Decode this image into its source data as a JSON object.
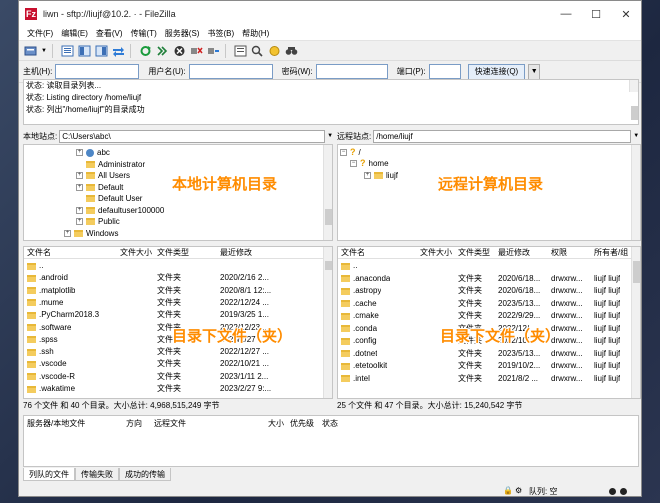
{
  "window": {
    "title": "liwn - sftp://liujf@10.2.  ·  - FileZilla",
    "app_icon": "Fz",
    "controls": [
      "—",
      "☐",
      "✕"
    ]
  },
  "menu": [
    "文件(F)",
    "编辑(E)",
    "查看(V)",
    "传输(T)",
    "服务器(S)",
    "书签(B)",
    "帮助(H)"
  ],
  "toolbar_icons": [
    "site-manager-icon",
    "dropdown-icon",
    "toggle-log-icon",
    "toggle-local-tree-icon",
    "toggle-remote-tree-icon",
    "toggle-queue-icon",
    "refresh-icon",
    "process-queue-icon",
    "cancel-icon",
    "disconnect-icon",
    "reconnect-icon",
    "filter-icon",
    "compare-icon",
    "sync-browse-icon",
    "search-icon"
  ],
  "quickconnect": {
    "host_label": "主机(H):",
    "user_label": "用户名(U):",
    "pass_label": "密码(W):",
    "port_label": "端口(P):",
    "host_value": "",
    "user_value": "",
    "pass_value": "",
    "port_value": "",
    "button": "快速连接(Q)",
    "dropdown": "▼"
  },
  "log": [
    "状态: 读取目录列表...",
    "状态: Listing directory /home/liujf",
    "状态: 列出\"/home/liujf\"的目录成功"
  ],
  "local": {
    "site_label": "本地站点:",
    "path": "C:\\Users\\abc\\",
    "tree": [
      {
        "name": "abc",
        "type": "user",
        "expander": "+"
      },
      {
        "name": "Administrator",
        "type": "folder",
        "expander": ""
      },
      {
        "name": "All Users",
        "type": "folder",
        "expander": "+"
      },
      {
        "name": "Default",
        "type": "folder",
        "expander": "+"
      },
      {
        "name": "Default User",
        "type": "folder",
        "expander": ""
      },
      {
        "name": "defaultuser100000",
        "type": "folder",
        "expander": "+"
      },
      {
        "name": "Public",
        "type": "folder",
        "expander": "+"
      },
      {
        "name": "Windows",
        "type": "folder",
        "expander": "+"
      }
    ],
    "columns": [
      "文件名",
      "文件大小",
      "文件类型",
      "最近修改"
    ],
    "files": [
      {
        "name": "..",
        "size": "",
        "type": "",
        "modified": ""
      },
      {
        "name": ".android",
        "size": "",
        "type": "文件夹",
        "modified": "2020/2/16 2..."
      },
      {
        "name": ".matplotlib",
        "size": "",
        "type": "文件夹",
        "modified": "2020/8/1 12:..."
      },
      {
        "name": ".mume",
        "size": "",
        "type": "文件夹",
        "modified": "2022/12/24 ..."
      },
      {
        "name": ".PyCharm2018.3",
        "size": "",
        "type": "文件夹",
        "modified": "2019/3/25 1..."
      },
      {
        "name": ".software",
        "size": "",
        "type": "文件夹",
        "modified": "2022/12/23 ..."
      },
      {
        "name": ".spss",
        "size": "",
        "type": "文件夹",
        "modified": "2023/2/27 ..."
      },
      {
        "name": ".ssh",
        "size": "",
        "type": "文件夹",
        "modified": "2022/12/27 ..."
      },
      {
        "name": ".vscode",
        "size": "",
        "type": "文件夹",
        "modified": "2022/10/21 ..."
      },
      {
        "name": ".vscode-R",
        "size": "",
        "type": "文件夹",
        "modified": "2023/1/11 2..."
      },
      {
        "name": ".wakatime",
        "size": "",
        "type": "文件夹",
        "modified": "2023/2/27 9:..."
      }
    ],
    "status": "76 个文件 和 40 个目录。大小总计: 4,968,515,249 字节"
  },
  "remote": {
    "site_label": "远程站点:",
    "path": "/home/liujf",
    "tree": [
      {
        "name": "/",
        "type": "unknown",
        "expander": "−"
      },
      {
        "name": "home",
        "type": "unknown",
        "expander": "−"
      },
      {
        "name": "liujf",
        "type": "folder",
        "expander": "+"
      }
    ],
    "columns": [
      "文件名",
      "文件大小",
      "文件类型",
      "最近修改",
      "权限",
      "所有者/组"
    ],
    "files": [
      {
        "name": "..",
        "size": "",
        "type": "",
        "modified": "",
        "perm": "",
        "owner": ""
      },
      {
        "name": ".anaconda",
        "size": "",
        "type": "文件夹",
        "modified": "2020/6/18...",
        "perm": "drwxrw...",
        "owner": "liujf liujf"
      },
      {
        "name": ".astropy",
        "size": "",
        "type": "文件夹",
        "modified": "2020/6/18...",
        "perm": "drwxrw...",
        "owner": "liujf liujf"
      },
      {
        "name": ".cache",
        "size": "",
        "type": "文件夹",
        "modified": "2023/5/13...",
        "perm": "drwxrw...",
        "owner": "liujf liujf"
      },
      {
        "name": ".cmake",
        "size": "",
        "type": "文件夹",
        "modified": "2022/9/29...",
        "perm": "drwxrw...",
        "owner": "liujf liujf"
      },
      {
        "name": ".conda",
        "size": "",
        "type": "文件夹",
        "modified": "2022/12/...",
        "perm": "drwxrw...",
        "owner": "liujf liujf"
      },
      {
        "name": ".config",
        "size": "",
        "type": "文件夹",
        "modified": "2022/10/...",
        "perm": "drwxrw...",
        "owner": "liujf liujf"
      },
      {
        "name": ".dotnet",
        "size": "",
        "type": "文件夹",
        "modified": "2023/5/13...",
        "perm": "drwxrw...",
        "owner": "liujf liujf"
      },
      {
        "name": ".etetoolkit",
        "size": "",
        "type": "文件夹",
        "modified": "2019/10/2...",
        "perm": "drwxrw...",
        "owner": "liujf liujf"
      },
      {
        "name": ".intel",
        "size": "",
        "type": "文件夹",
        "modified": "2021/8/2 ...",
        "perm": "drwxrw...",
        "owner": "liujf liujf"
      }
    ],
    "status": "25 个文件 和 47 个目录。大小总计: 15,240,542 字节"
  },
  "queue": {
    "columns": [
      "服务器/本地文件",
      "方向",
      "远程文件",
      "大小",
      "优先级",
      "状态"
    ],
    "tabs": [
      "列队的文件",
      "传输失败",
      "成功的传输"
    ]
  },
  "statusbar": {
    "queue_label": "队列: 空"
  },
  "overlays": {
    "local_tree": "本地计算机目录",
    "remote_tree": "远程计算机目录",
    "local_files": "目录下文件（夹）",
    "remote_files": "目录下文件（夹）"
  },
  "colors": {
    "overlay": "#ff8c00",
    "folder": "#f4cc5e",
    "accent": "#7a9cc6"
  }
}
